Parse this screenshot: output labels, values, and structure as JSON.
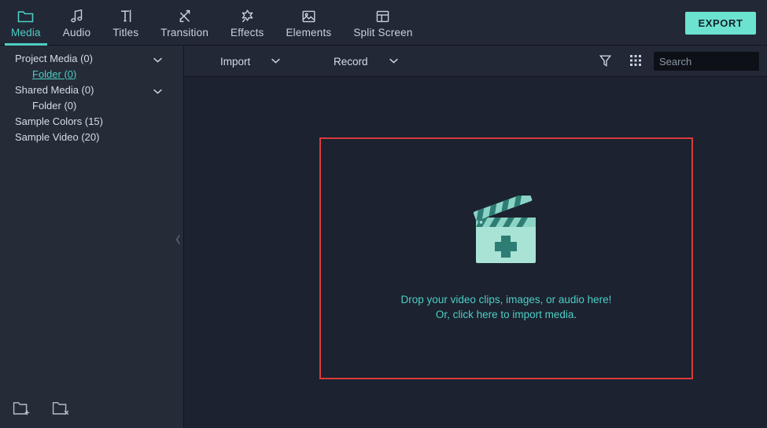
{
  "app": {
    "accent_color": "#4ecdc4",
    "export_color": "#6be3d0",
    "highlight_box_color": "#d93b3b",
    "panel_bg": "#1c2230",
    "sidebar_bg": "#252c38"
  },
  "tabbar": {
    "tabs": [
      {
        "label": "Media",
        "icon": "folder-icon",
        "active": true
      },
      {
        "label": "Audio",
        "icon": "music-note-icon",
        "active": false
      },
      {
        "label": "Titles",
        "icon": "text-cursor-icon",
        "active": false
      },
      {
        "label": "Transition",
        "icon": "transition-icon",
        "active": false
      },
      {
        "label": "Effects",
        "icon": "sparkle-icon",
        "active": false
      },
      {
        "label": "Elements",
        "icon": "image-icon",
        "active": false
      },
      {
        "label": "Split Screen",
        "icon": "split-screen-icon",
        "active": false
      }
    ],
    "export_label": "EXPORT"
  },
  "sidebar": {
    "tree": [
      {
        "label": "Project Media (0)",
        "level": 0,
        "chevron": "chevron-down-icon",
        "selected": false
      },
      {
        "label": "Folder (0)",
        "level": 1,
        "chevron": "",
        "selected": true
      },
      {
        "label": "Shared Media (0)",
        "level": 0,
        "chevron": "chevron-down-icon",
        "selected": false
      },
      {
        "label": "Folder (0)",
        "level": 1,
        "chevron": "",
        "selected": false
      },
      {
        "label": "Sample Colors (15)",
        "level": 0,
        "chevron": "",
        "selected": false
      },
      {
        "label": "Sample Video (20)",
        "level": 0,
        "chevron": "",
        "selected": false
      }
    ],
    "footer_icons": [
      {
        "name": "new-folder-icon",
        "glyph": "folder-plus"
      },
      {
        "name": "delete-folder-icon",
        "glyph": "folder-x"
      }
    ],
    "collapse_icon": "chevron-left-icon"
  },
  "toolbar": {
    "import_label": "Import",
    "import_chevron": "chevron-down-icon",
    "record_label": "Record",
    "record_chevron": "chevron-down-icon",
    "filter_icon": "filter-funnel-icon",
    "grid_icon": "grid-view-icon"
  },
  "search": {
    "placeholder": "Search",
    "value": "",
    "icon": "search-icon"
  },
  "dropzone": {
    "icon": "clapperboard-plus-icon",
    "line1": "Drop your video clips, images, or audio here!",
    "line2": "Or, click here to import media."
  }
}
